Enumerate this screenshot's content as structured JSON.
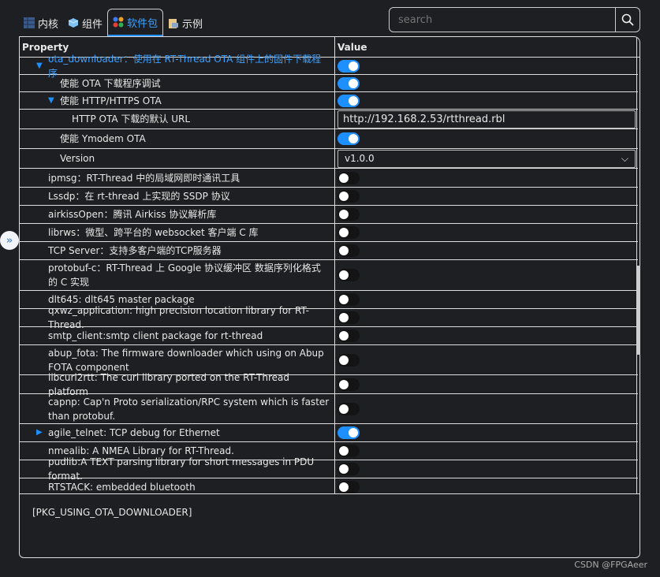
{
  "tabs": [
    {
      "label": "内核",
      "icon": "grid-icon"
    },
    {
      "label": "组件",
      "icon": "cube-icon"
    },
    {
      "label": "软件包",
      "icon": "packages-icon",
      "active": true
    },
    {
      "label": "示例",
      "icon": "clipboard-icon"
    }
  ],
  "search": {
    "placeholder": "search"
  },
  "table": {
    "headers": {
      "property": "Property",
      "value": "Value"
    },
    "rows": [
      {
        "label": "ota_downloader：使用在 RT-Thread OTA 组件上的固件下载程序",
        "level": 0,
        "arrow": "down",
        "highlight": true,
        "type": "toggle",
        "on": true
      },
      {
        "label": "使能 OTA 下载程序调试",
        "level": 1,
        "type": "toggle",
        "on": true
      },
      {
        "label": "使能 HTTP/HTTPS OTA",
        "level": 1,
        "arrow": "down",
        "type": "toggle",
        "on": true
      },
      {
        "label": "HTTP OTA 下载的默认 URL",
        "level": 2,
        "type": "text",
        "value": "http://192.168.2.53/rtthread.rbl"
      },
      {
        "label": "使能 Ymodem OTA",
        "level": 1,
        "type": "toggle",
        "on": true
      },
      {
        "label": "Version",
        "level": 1,
        "type": "select",
        "value": "v1.0.0"
      },
      {
        "label": "ipmsg：RT-Thread 中的局域网即时通讯工具",
        "level": 0,
        "type": "toggle",
        "on": false
      },
      {
        "label": "Lssdp：在 rt-thread 上实现的 SSDP 协议",
        "level": 0,
        "type": "toggle",
        "on": false
      },
      {
        "label": "airkissOpen：腾讯 Airkiss 协议解析库",
        "level": 0,
        "type": "toggle",
        "on": false
      },
      {
        "label": "librws：微型、跨平台的 websocket 客户端 C 库",
        "level": 0,
        "type": "toggle",
        "on": false
      },
      {
        "label": "TCP Server：支持多客户端的TCP服务器",
        "level": 0,
        "type": "toggle",
        "on": false
      },
      {
        "label": "protobuf-c：RT-Thread 上 Google 协议缓冲区 数据序列化格式的 C 实现",
        "level": 0,
        "type": "toggle",
        "on": false,
        "tall": true
      },
      {
        "label": "dlt645: dlt645 master package",
        "level": 0,
        "type": "toggle",
        "on": false
      },
      {
        "label": "qxwz_application: high precision location library for RT-Thread.",
        "level": 0,
        "type": "toggle",
        "on": false
      },
      {
        "label": "smtp_client:smtp client package for rt-thread",
        "level": 0,
        "type": "toggle",
        "on": false
      },
      {
        "label": "abup_fota: The firmware downloader which using on Abup FOTA component",
        "level": 0,
        "type": "toggle",
        "on": false,
        "tall": true
      },
      {
        "label": "libcurl2rtt: The curl library ported on the RT-Thread platform",
        "level": 0,
        "type": "toggle",
        "on": false
      },
      {
        "label": "capnp: Cap'n Proto serialization/RPC system which is faster than protobuf.",
        "level": 0,
        "type": "toggle",
        "on": false,
        "tall": true
      },
      {
        "label": "agile_telnet: TCP debug for Ethernet",
        "level": 0,
        "arrow": "right",
        "type": "toggle",
        "on": true
      },
      {
        "label": "nmealib: A NMEA Library for RT-Thread.",
        "level": 0,
        "type": "toggle",
        "on": false
      },
      {
        "label": "pudlib:A TEXT parsing library for short messages in PDU format.",
        "level": 0,
        "type": "toggle",
        "on": false
      },
      {
        "label": "RTSTACK: embedded bluetooth",
        "level": 0,
        "type": "toggle",
        "on": false
      }
    ]
  },
  "description": "[PKG_USING_OTA_DOWNLOADER]",
  "watermark": "CSDN @FPGAeer",
  "colors": {
    "accent": "#1e8fff",
    "background": "#1e1f22"
  }
}
